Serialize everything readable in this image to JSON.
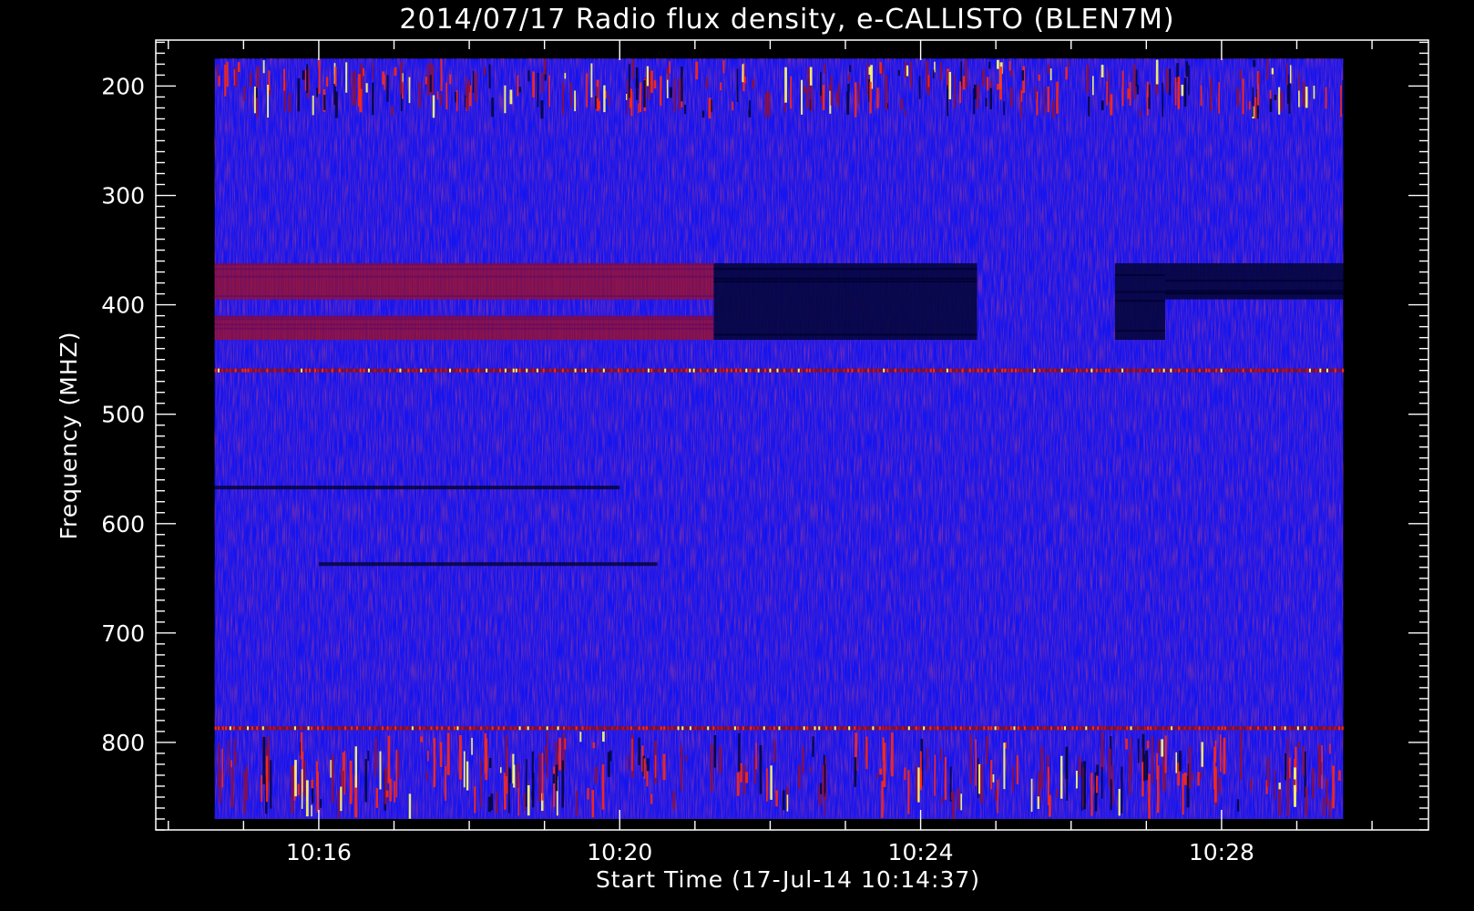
{
  "chart_data": {
    "type": "heatmap",
    "title": "2014/07/17  Radio flux density, e-CALLISTO (BLEN7M)",
    "xlabel": "Start Time (17-Jul-14 10:14:37)",
    "ylabel": "Frequency (MHZ)",
    "x_axis": {
      "unit": "time",
      "range": [
        "10:14:37",
        "10:29:37"
      ],
      "view_range": [
        "10:13:50",
        "10:30:45"
      ],
      "major_ticks": [
        "10:16",
        "10:20",
        "10:24",
        "10:28"
      ],
      "minor_tick_step_seconds": 60
    },
    "y_axis": {
      "unit": "MHz",
      "inverted": true,
      "data_range": [
        175,
        870
      ],
      "view_range": [
        158,
        880
      ],
      "major_ticks": [
        200,
        300,
        400,
        500,
        600,
        700,
        800
      ],
      "minor_tick_step": 10
    },
    "colormap": {
      "background": "#1414f0",
      "low": "#05053a",
      "mid": "#8a1040",
      "high": "#ff2a10",
      "peak": "#ffff70"
    },
    "features": [
      {
        "kind": "band-enhanced",
        "freq": [
          362,
          395
        ],
        "time": [
          "10:14:37",
          "10:21:15"
        ]
      },
      {
        "kind": "band-enhanced",
        "freq": [
          410,
          432
        ],
        "time": [
          "10:14:37",
          "10:21:15"
        ]
      },
      {
        "kind": "band-depressed",
        "freq": [
          362,
          432
        ],
        "time": [
          "10:21:15",
          "10:24:45"
        ]
      },
      {
        "kind": "band-depressed",
        "freq": [
          362,
          432
        ],
        "time": [
          "10:26:35",
          "10:27:15"
        ]
      },
      {
        "kind": "band-depressed",
        "freq": [
          362,
          395
        ],
        "time": [
          "10:27:15",
          "10:29:37"
        ]
      },
      {
        "kind": "interference-line",
        "freq": 460,
        "time": [
          "10:14:37",
          "10:29:37"
        ]
      },
      {
        "kind": "interference-line",
        "freq": 787,
        "time": [
          "10:14:37",
          "10:29:37"
        ]
      },
      {
        "kind": "dark-line",
        "freq": 567,
        "time": [
          "10:14:37",
          "10:20:00"
        ]
      },
      {
        "kind": "dark-line",
        "freq": 637,
        "time": [
          "10:16:00",
          "10:20:30"
        ]
      },
      {
        "kind": "burst-cluster",
        "freq": [
          790,
          870
        ],
        "time": [
          "10:14:37",
          "10:29:37"
        ]
      },
      {
        "kind": "burst-cluster",
        "freq": [
          175,
          230
        ],
        "time": [
          "10:14:37",
          "10:29:37"
        ]
      }
    ]
  }
}
